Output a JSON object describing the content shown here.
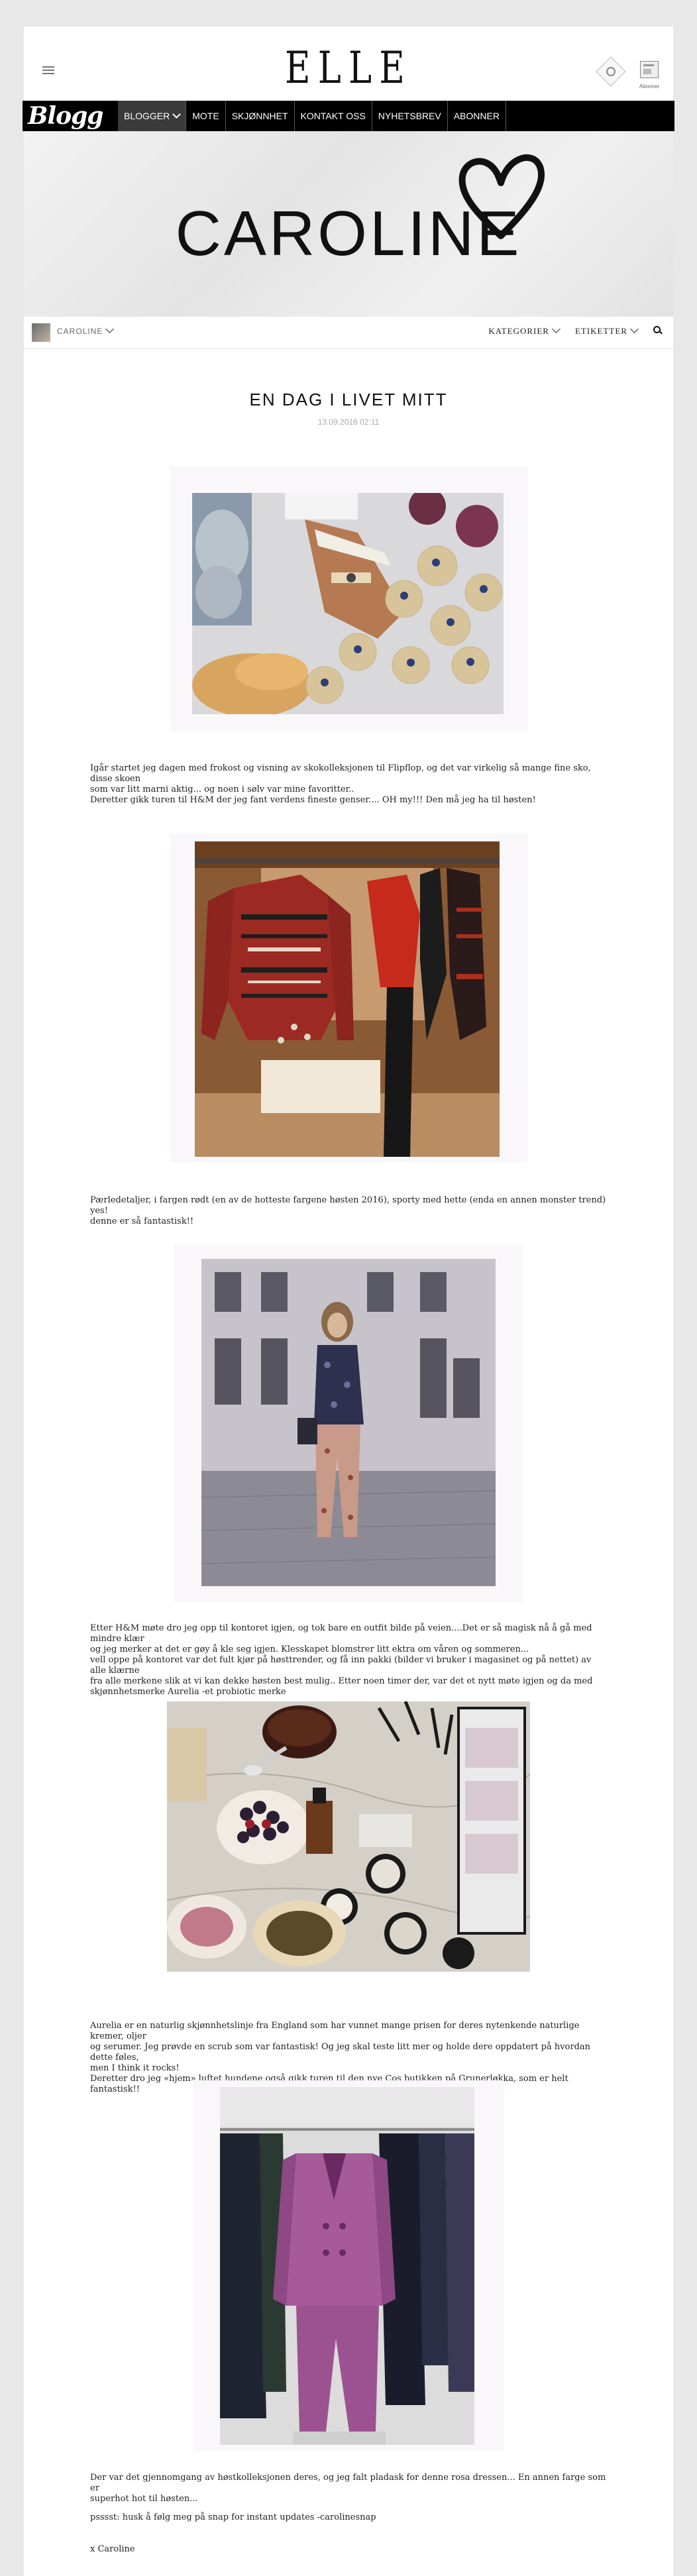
{
  "header": {
    "logo": "ELLE",
    "abonner_label": "Abonner"
  },
  "nav": {
    "blogg_logo": "Blogg",
    "items": [
      {
        "label": "BLOGGER",
        "active": true
      },
      {
        "label": "MOTE"
      },
      {
        "label": "SKJØNNHET"
      },
      {
        "label": "KONTAKT OSS"
      },
      {
        "label": "NYHETSBREV"
      },
      {
        "label": "ABONNER"
      }
    ]
  },
  "banner": {
    "title": "CAROLINE"
  },
  "subnav": {
    "author": "CAROLINE",
    "categories": "KATEGORIER",
    "tags": "ETIKETTER"
  },
  "post": {
    "title": "EN DAG I LIVET MITT",
    "date": "13.09.2016 02:11",
    "paragraphs": [
      [
        "Igår startet jeg dagen med frokost og visning av skokolleksjonen til Flipflop, og det var virkelig så mange fine sko, disse skoen",
        "som var litt marni aktig... og noen i sølv var mine favoritter..",
        "Deretter gikk turen til H&M der jeg fant verdens fineste genser.... OH my!!! Den må jeg ha til høsten!"
      ],
      [
        "Pærledetaljer, i fargen rødt (en av de hotteste fargene høsten 2016), sporty med  hette (enda en annen monster trend) yes!",
        "denne er så fantastisk!!"
      ],
      [
        "Etter H&M møte dro jeg opp til kontoret igjen, og tok bare en outfit bilde på veien....Det er så magisk nå å gå med mindre klær",
        "og jeg merker at det er gøy å kle seg igjen. Klesskapet blomstrer litt ektra om våren og sommeren...",
        "vell oppe på kontoret var det fult kjør på høsttrender, og få inn pakki (bilder vi bruker i magasinet og på nettet) av alle klærne",
        "fra alle merkene slik at vi kan dekke høsten best mulig.. Etter noen timer der, var det et nytt møte igjen og da med",
        "skjønnhetsmerke Aurelia -et probiotic merke"
      ],
      [
        "Aurelia er en naturlig skjønnhetslinje fra England som har vunnet mange prisen for deres nytenkende naturlige kremer, oljer",
        "og serumer. Jeg prøvde en scrub som var fantastisk! Og jeg skal teste litt mer og holde dere oppdatert på hvordan dette føles,",
        "men I think it rocks!",
        "Deretter dro jeg «hjem» luftet hundene også gikk turen til den nye Cos butikken på Grunerløkka, som er helt fantastisk!!"
      ],
      [
        "Der var det gjennomgang av høstkolleksjonen deres, og jeg falt pladask for denne rosa dressen... En annen farge som er",
        "superhot hot til høsten..."
      ],
      [
        "psssst: husk å følg meg på snap for instant updates -carolinesnap"
      ],
      [
        "x Caroline"
      ]
    ]
  },
  "colors": {
    "nav_bg": "#000000",
    "page_bg": "#ffffff",
    "outer_bg": "#e8e8e8"
  }
}
